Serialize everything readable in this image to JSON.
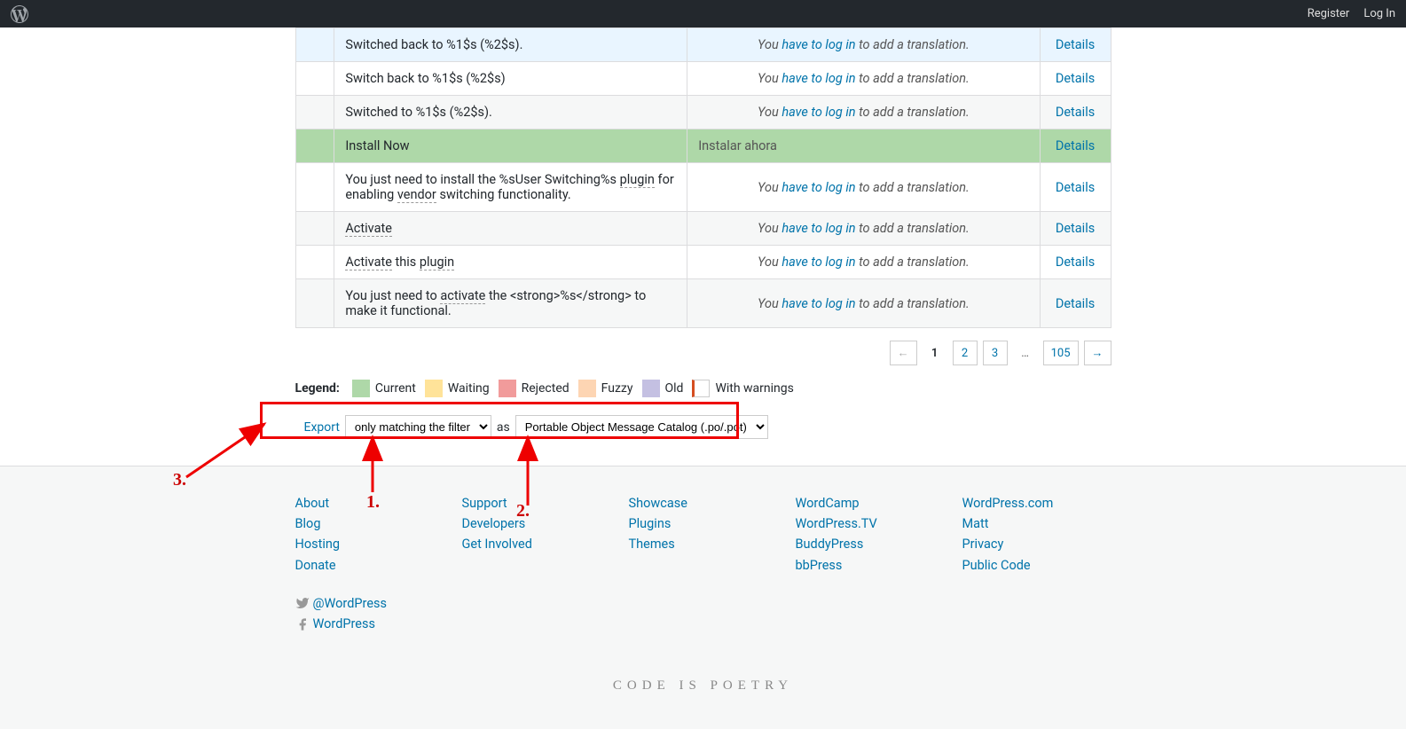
{
  "adminbar": {
    "register": "Register",
    "login": "Log In"
  },
  "rows": [
    {
      "cls": "row-fuzzy",
      "orig_html": "Switched back to %1$s (%2$s).",
      "trans_html": "You <a class='login-link' href='#'>have to log in</a> to add a translation.",
      "details": "Details"
    },
    {
      "cls": "row-odd",
      "orig_html": "Switch back to %1$s (%2$s)",
      "trans_html": "You <a class='login-link' href='#'>have to log in</a> to add a translation.",
      "details": "Details"
    },
    {
      "cls": "row-even",
      "orig_html": "Switched to %1$s (%2$s).",
      "trans_html": "You <a class='login-link' href='#'>have to log in</a> to add a translation.",
      "details": "Details"
    },
    {
      "cls": "row-current",
      "orig_html": "Install Now",
      "trans_plain": "Instalar ahora",
      "details": "Details"
    },
    {
      "cls": "row-odd",
      "orig_html": "You just need to install the %sUser Switching%s <span class='dotted'>plugin</span> for enabling <span class='dotted'>vendor</span> switching functionality.",
      "trans_html": "You <a class='login-link' href='#'>have to log in</a> to add a translation.",
      "details": "Details"
    },
    {
      "cls": "row-even",
      "orig_html": "<span class='dotted'>Activate</span>",
      "trans_html": "You <a class='login-link' href='#'>have to log in</a> to add a translation.",
      "details": "Details"
    },
    {
      "cls": "row-odd",
      "orig_html": "<span class='dotted'>Activate</span> this <span class='dotted'>plugin</span>",
      "trans_html": "You <a class='login-link' href='#'>have to log in</a> to add a translation.",
      "details": "Details"
    },
    {
      "cls": "row-even",
      "orig_html": "You just need to <span class='dotted'>activate</span> the &lt;strong&gt;%s&lt;/strong&gt; to make it functional.",
      "trans_html": "You <a class='login-link' href='#'>have to log in</a> to add a translation.",
      "details": "Details"
    }
  ],
  "pagination": {
    "prev": "←",
    "pages": [
      "1",
      "2",
      "3"
    ],
    "dots": "…",
    "last": "105",
    "next": "→"
  },
  "legend": {
    "label": "Legend:",
    "current": "Current",
    "waiting": "Waiting",
    "rejected": "Rejected",
    "fuzzy": "Fuzzy",
    "old": "Old",
    "warnings": "With warnings"
  },
  "export": {
    "link": "Export",
    "filter_selected": "only matching the filter",
    "as": "as",
    "format_selected": "Portable Object Message Catalog (.po/.pot)"
  },
  "annotations": {
    "n1": "1.",
    "n2": "2.",
    "n3": "3."
  },
  "footer": {
    "col1": [
      "About",
      "Blog",
      "Hosting",
      "Donate"
    ],
    "col2": [
      "Support",
      "Developers",
      "Get Involved"
    ],
    "col3": [
      "Showcase",
      "Plugins",
      "Themes"
    ],
    "col4": [
      "WordCamp",
      "WordPress.TV",
      "BuddyPress",
      "bbPress"
    ],
    "col5": [
      "WordPress.com",
      "Matt",
      "Privacy",
      "Public Code"
    ],
    "social": {
      "twitter": "@WordPress",
      "facebook": "WordPress"
    },
    "tagline": "Code is Poetry"
  }
}
